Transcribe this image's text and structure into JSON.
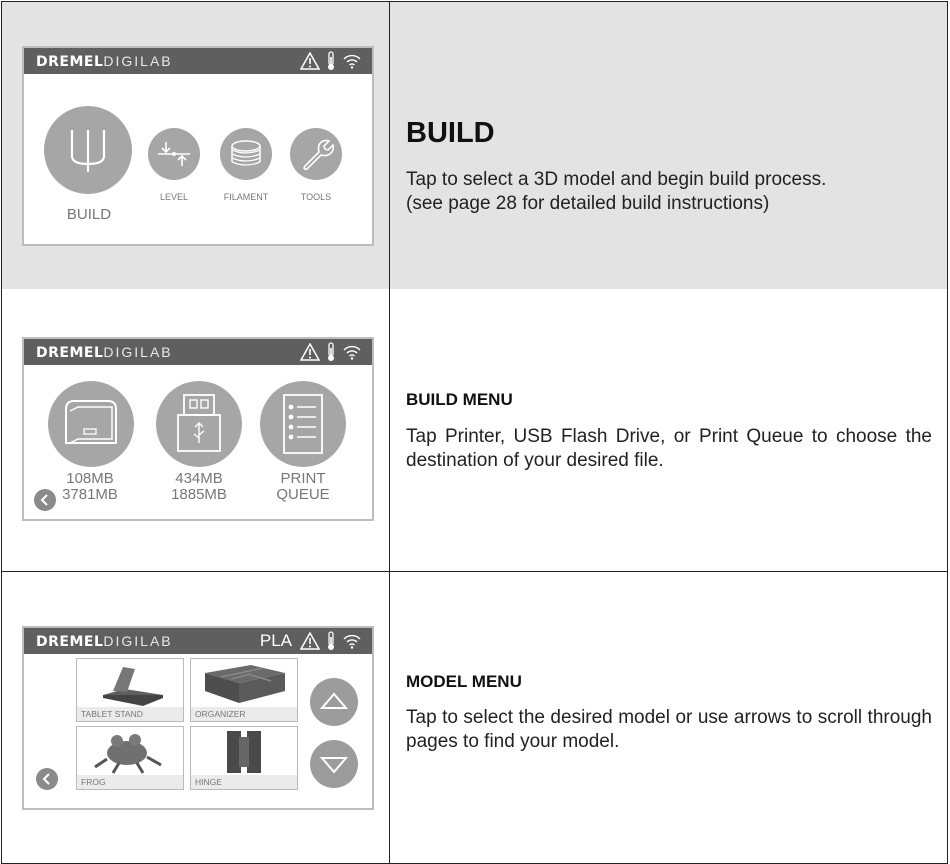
{
  "brand": {
    "bold": "DREMEL",
    "light": "DIGILAB"
  },
  "row1": {
    "screen": {
      "build_label": "BUILD",
      "level_label": "LEVEL",
      "filament_label": "FILAMENT",
      "tools_label": "TOOLS"
    },
    "title": "BUILD",
    "description_line1": "Tap to select a 3D model and begin build process.",
    "description_line2": "(see page 28 for detailed build instructions)"
  },
  "row2": {
    "screen": {
      "printer_line1": "108MB",
      "printer_line2": "3781MB",
      "usb_line1": "434MB",
      "usb_line2": "1885MB",
      "queue_line1": "PRINT",
      "queue_line2": "QUEUE"
    },
    "title": "BUILD MENU",
    "description": "Tap Printer, USB Flash Drive, or Print Queue to choose the destination of your desired file."
  },
  "row3": {
    "screen": {
      "material": "PLA",
      "models": [
        "TABLET STAND",
        "ORGANIZER",
        "FROG",
        "HINGE"
      ]
    },
    "title": "MODEL MENU",
    "description": "Tap to select the desired model or use arrows to scroll through pages to find your model."
  },
  "colors": {
    "header_bar": "#5f5f5f",
    "icon_circle": "#a6a6a6",
    "row1_bg": "#e3e3e3"
  },
  "icons": [
    "warning-icon",
    "thermometer-icon",
    "wifi-icon",
    "back-icon",
    "arrow-up-icon",
    "arrow-down-icon"
  ]
}
